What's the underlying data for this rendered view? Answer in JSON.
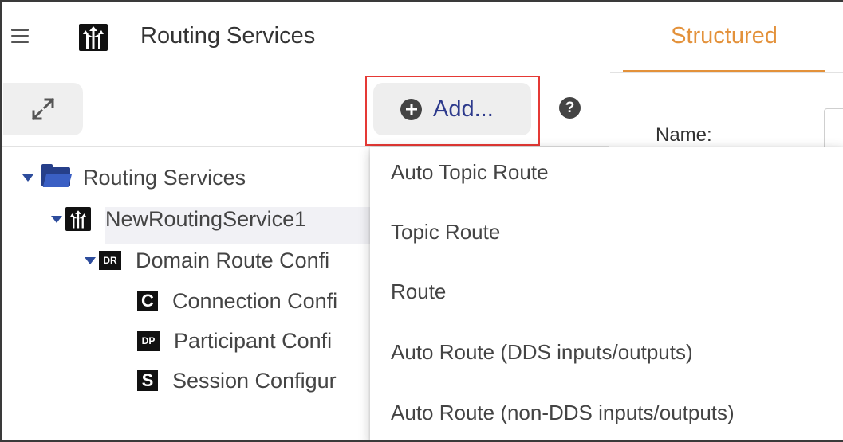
{
  "header": {
    "menu_icon": "hamburger-icon",
    "logo_icon": "routing-service-logo-icon",
    "title": "Routing Services"
  },
  "toolbar": {
    "expand_icon": "expand-arrows-icon",
    "add_label": "Add...",
    "add_icon": "plus-circle-icon",
    "help_label": "?"
  },
  "tree": {
    "items": [
      {
        "label": "Routing Services",
        "icon": "folder-open-icon",
        "expanded": true
      },
      {
        "label": "NewRoutingService1",
        "icon": "routing-service-icon",
        "expanded": true
      },
      {
        "label": "Domain Route Confi",
        "icon": "domain-route-icon",
        "icon_text": "DR",
        "expanded": true
      },
      {
        "label": "Connection Confi",
        "icon": "connection-icon",
        "icon_text": "C"
      },
      {
        "label": "Participant Confi",
        "icon": "participant-icon",
        "icon_text": "DP"
      },
      {
        "label": "Session Configur",
        "icon": "session-icon",
        "icon_text": "S",
        "selected": true
      }
    ]
  },
  "right_panel": {
    "tab_label": "Structured",
    "name_label": "Name:"
  },
  "add_menu": {
    "items": [
      "Auto Topic Route",
      "Topic Route",
      "Route",
      "Auto Route (DDS inputs/outputs)",
      "Auto Route (non-DDS inputs/outputs)"
    ]
  },
  "colors": {
    "accent_tab": "#e3913a",
    "add_label": "#2d3a8c",
    "tree_caret": "#2d4c9c",
    "highlight_border": "#e53935"
  }
}
